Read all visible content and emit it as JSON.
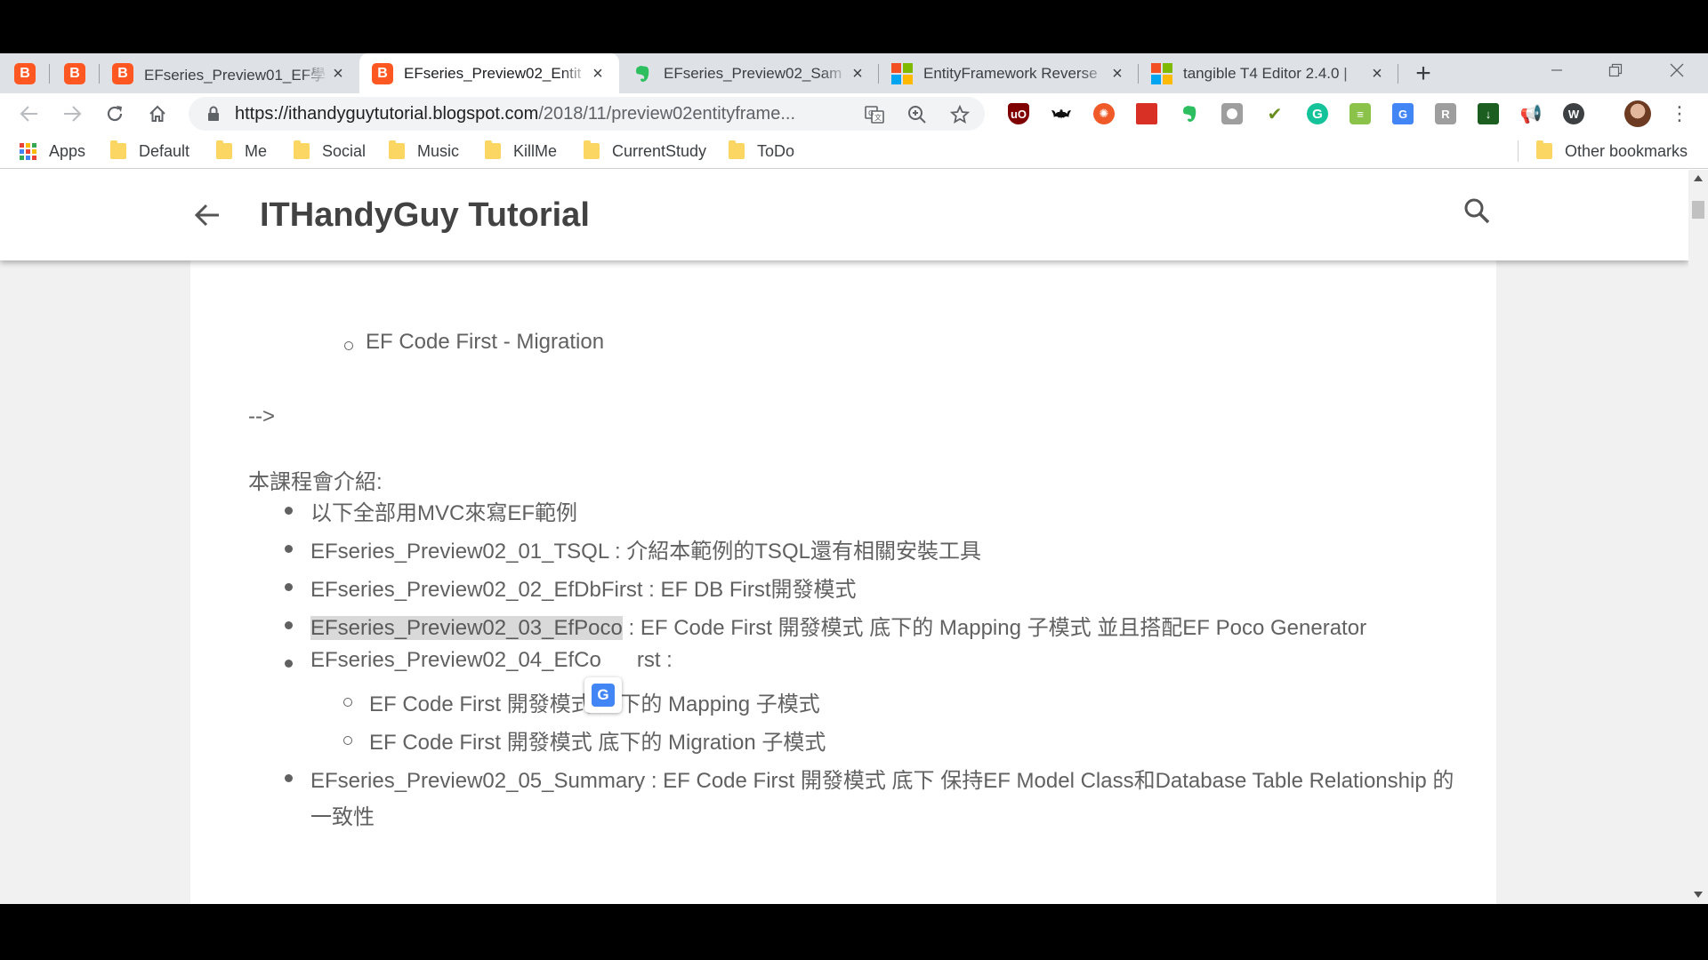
{
  "tabs": {
    "pinned": [
      {
        "icon": "blogger-icon"
      },
      {
        "icon": "blogger-icon"
      }
    ],
    "open": [
      {
        "title": "EFseries_Preview01_EF學",
        "icon": "blogger-icon",
        "active": false
      },
      {
        "title": "EFseries_Preview02_Entit",
        "icon": "blogger-icon",
        "active": true
      },
      {
        "title": "EFseries_Preview02_Sam",
        "icon": "evernote-icon",
        "active": false
      },
      {
        "title": "EntityFramework Reverse",
        "icon": "microsoft-icon",
        "active": false
      },
      {
        "title": "tangible T4 Editor 2.4.0 |",
        "icon": "microsoft-icon",
        "active": false
      }
    ],
    "new_tab": "+"
  },
  "toolbar": {
    "url_host": "https://ithandyguytutorial.blogspot.com",
    "url_path": "/2018/11/preview02entityframe...",
    "extensions": [
      "ublock-icon",
      "batman-icon",
      "orange-circle-icon",
      "red-book-icon",
      "evernote-icon",
      "square-icon",
      "check-icon",
      "grammarly-icon",
      "green-ext-icon",
      "google-translate-icon",
      "grey-ext-icon",
      "download-icon",
      "megaphone-icon",
      "w-ext-icon"
    ]
  },
  "bookmarks": {
    "apps": "Apps",
    "folders": [
      "Default",
      "Me",
      "Social",
      "Music",
      "KillMe",
      "CurrentStudy",
      "ToDo"
    ],
    "other": "Other bookmarks"
  },
  "page": {
    "blog_title": "ITHandyGuy Tutorial",
    "sub_item_top": "EF Code First - Migration",
    "comment_end": "-->",
    "intro_heading": "本課程會介紹:",
    "items": [
      "以下全部用MVC來寫EF範例",
      "EFseries_Preview02_01_TSQL : 介紹本範例的TSQL還有相關安裝工具",
      "EFseries_Preview02_02_EfDbFirst : EF DB First開發模式"
    ],
    "item4_highlight": "EFseries_Preview02_03_EfPoco",
    "item4_rest": " : EF Code First 開發模式 底下的 Mapping 子模式 並且搭配EF Poco Generator",
    "item5_a": "EFseries_Preview02_04_EfCo",
    "item5_b": "rst :",
    "sub_items": [
      "EF Code First 開發模式 底下的 Mapping 子模式",
      "EF Code First 開發模式 底下的 Migration 子模式"
    ],
    "item6_line1": "EFseries_Preview02_05_Summary : EF Code First 開發模式 底下 保持EF Model Class和Database Table Relationship 的",
    "item6_line2": "一致性"
  }
}
